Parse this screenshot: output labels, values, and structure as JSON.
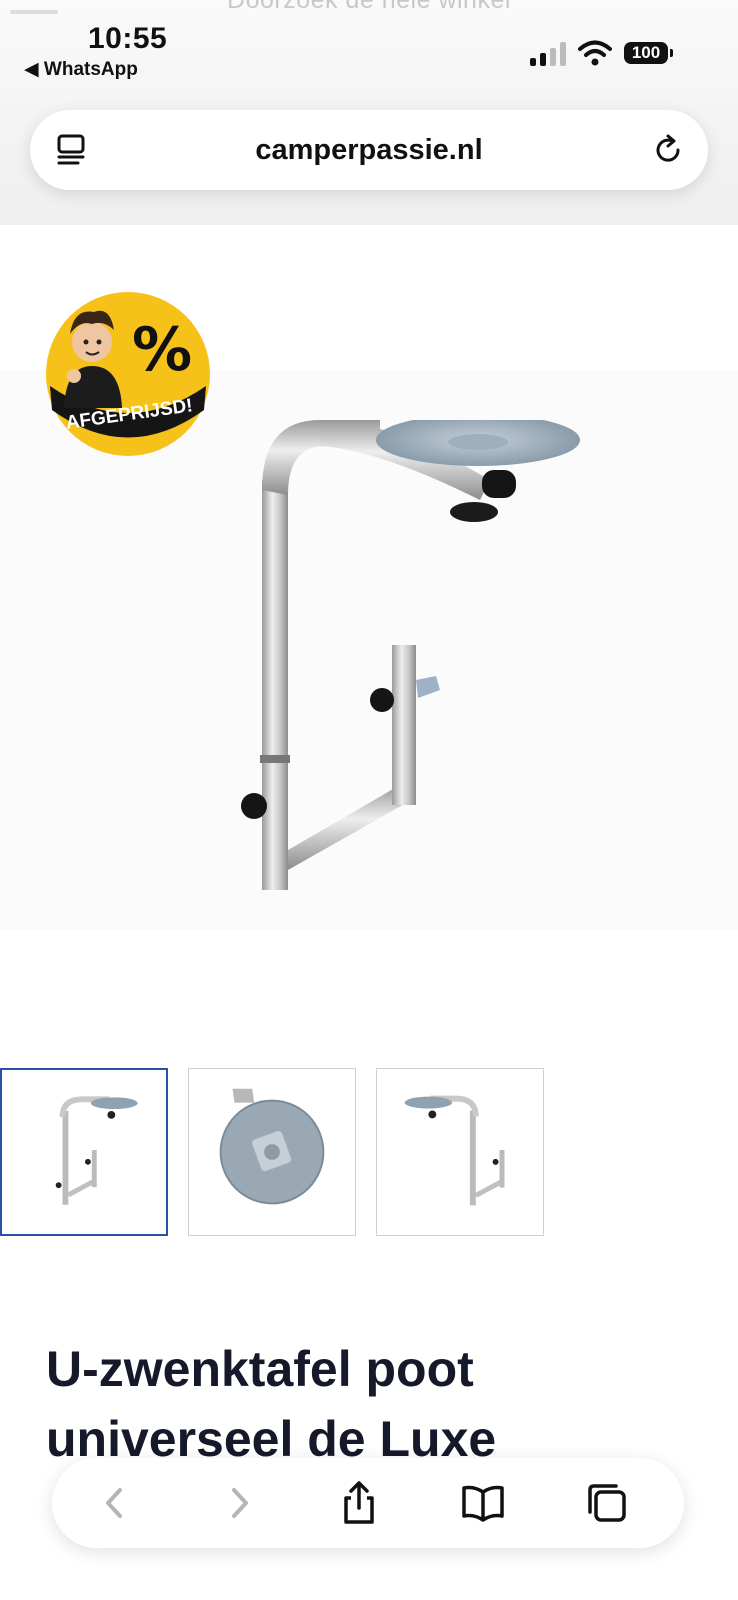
{
  "status_bar": {
    "time": "10:55",
    "back_app": "WhatsApp",
    "battery": "100"
  },
  "browser": {
    "url": "camperpassie.nl"
  },
  "badge": {
    "percent": "%",
    "text": "AFGEPRIJSD!"
  },
  "product": {
    "title_line1": "U-zwenktafel poot",
    "title_line2": "universeel de Luxe"
  },
  "thumbnails": [
    {
      "name": "thumbnail-1"
    },
    {
      "name": "thumbnail-2"
    },
    {
      "name": "thumbnail-3"
    }
  ],
  "colors": {
    "accent_border": "#2a4fa8",
    "badge_yellow": "#f6c21a",
    "title": "#15192a"
  }
}
